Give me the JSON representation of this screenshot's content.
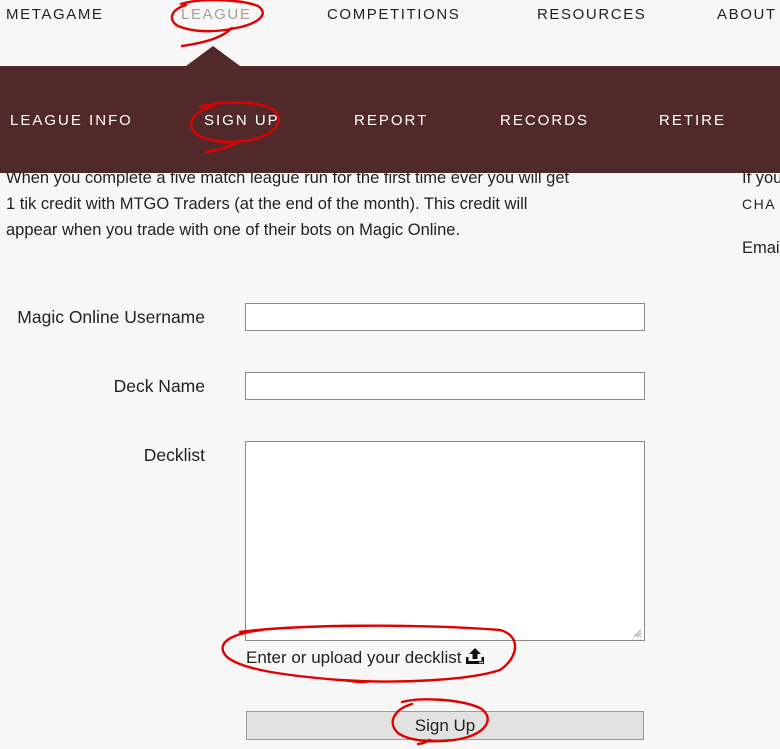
{
  "top_nav": {
    "metagame": "METAGAME",
    "league": "LEAGUE",
    "competitions": "COMPETITIONS",
    "resources": "RESOURCES",
    "about": "ABOUT"
  },
  "sub_nav": {
    "league_info": "LEAGUE INFO",
    "sign_up": "SIGN UP",
    "report": "REPORT",
    "records": "RECORDS",
    "retire": "RETIRE"
  },
  "intro": {
    "line1": "When you complete a five match league run for the first time ever you will get",
    "line2": "1 tik credit with MTGO Traders (at the end of the month). This credit will",
    "line3": "appear when you trade with one of their bots on Magic Online."
  },
  "sidebar": {
    "line1": "If you",
    "line2": "CHA",
    "line3": "Emai"
  },
  "form": {
    "username_label": "Magic Online Username",
    "username_value": "",
    "deck_name_label": "Deck Name",
    "deck_name_value": "",
    "decklist_label": "Decklist",
    "decklist_value": "",
    "decklist_hint": "Enter or upload your decklist",
    "submit_label": "Sign Up"
  },
  "colors": {
    "nav_bar": "#52292a",
    "active_nav": "#a39f9b",
    "annotation": "#e00000"
  },
  "icons": {
    "upload": "upload-icon"
  }
}
